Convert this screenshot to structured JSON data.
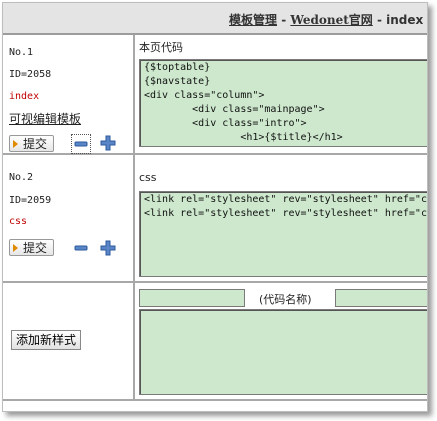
{
  "header": {
    "title": "模板管理",
    "sep1": " - ",
    "site": "Wedonet官网",
    "sep2": " - ",
    "page": "index"
  },
  "rows": [
    {
      "no": "No.1",
      "id": "ID=2058",
      "name": "index",
      "edit_link": "可视编辑模板",
      "submit": "提交",
      "code_title": "本页代码",
      "code_lines": [
        "{$toptable}",
        "{$navstate}",
        "<div class=\"column\">",
        "        <div class=\"mainpage\">",
        "        <div class=\"intro\">",
        "                <h1>{$title}</h1>"
      ]
    },
    {
      "no": "No.2",
      "id": "ID=2059",
      "name": "css",
      "submit": "提交",
      "code_title": "css",
      "code_lines": [
        "<link rel=\"stylesheet\" rev=\"stylesheet\" href=\"cs",
        "<link rel=\"stylesheet\" rev=\"stylesheet\" href=\"cs"
      ]
    }
  ],
  "new": {
    "add_button": "添加新样式",
    "name_placeholder": "(代码名称)"
  },
  "icons": {
    "remove": "minus-icon",
    "add": "plus-icon",
    "submit_arrow": "arrow-right-icon"
  },
  "colors": {
    "code_bg": "#cde8cd",
    "name_red": "#c00000",
    "header_bg": "#e4e4e4"
  }
}
